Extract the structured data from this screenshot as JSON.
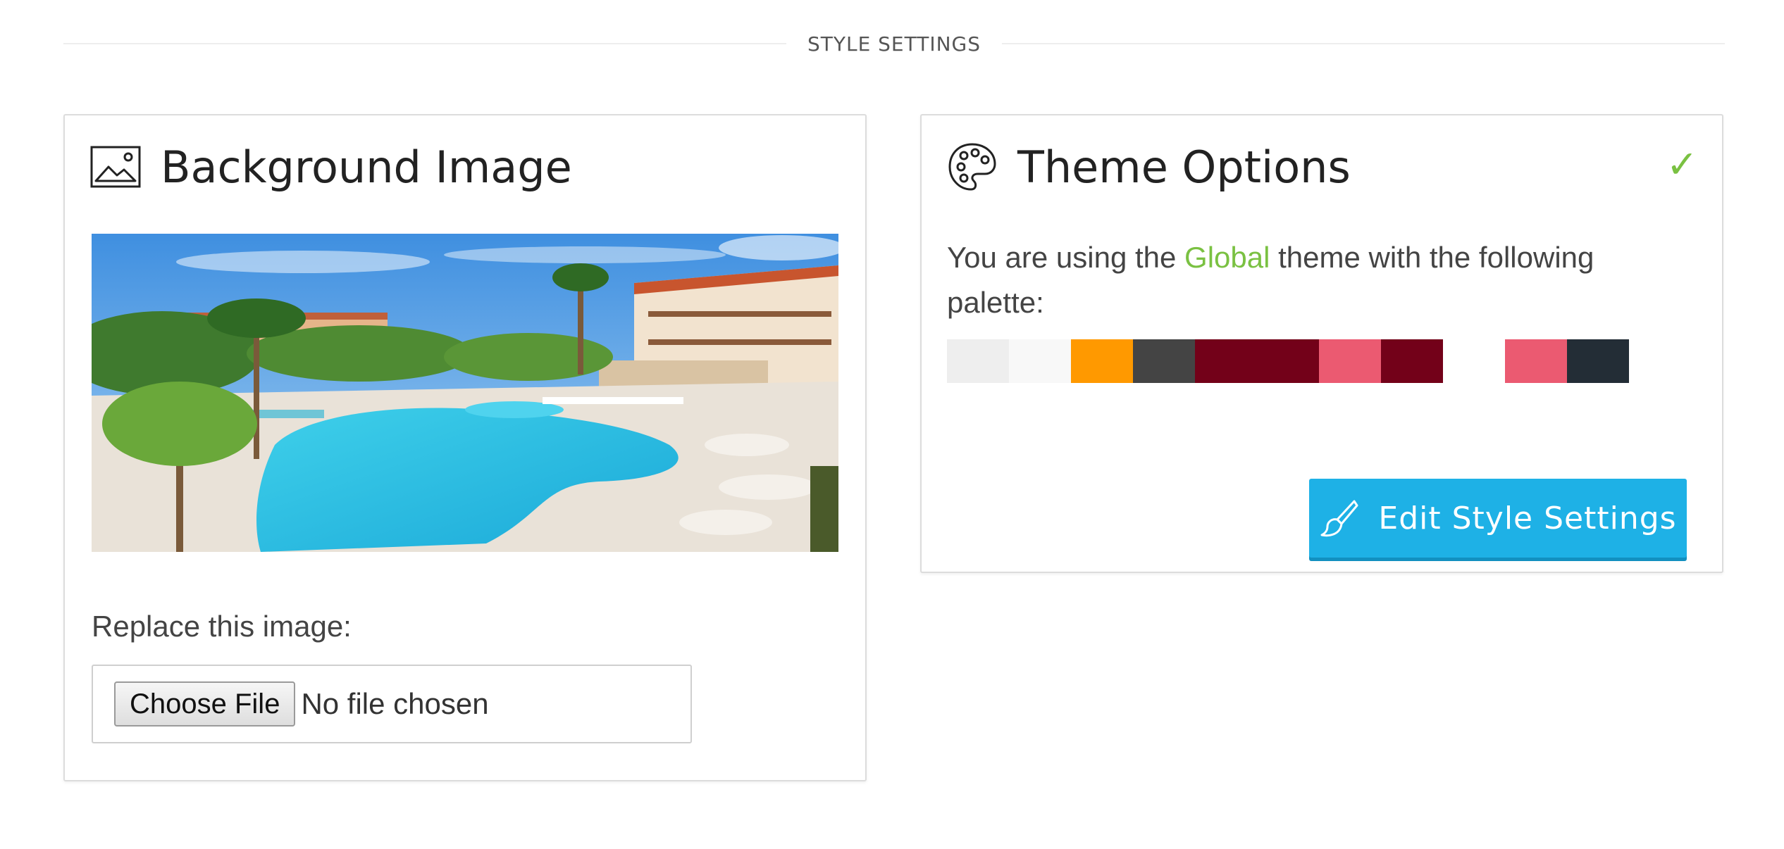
{
  "section": {
    "title": "STYLE SETTINGS"
  },
  "background_panel": {
    "title": "Background Image",
    "icon": "image-icon",
    "replace_label": "Replace this image:",
    "file_button_label": "Choose File",
    "file_status": "No file chosen"
  },
  "theme_panel": {
    "title": "Theme Options",
    "icon": "palette-icon",
    "status_icon": "checkmark-icon",
    "status_glyph": "✓",
    "text_before": "You are using the ",
    "theme_name": "Global",
    "text_after": " theme with the following palette:",
    "palette": [
      "#eeeeee",
      "#f8f8f8",
      "#ff9900",
      "#444444",
      "#730119",
      "#730119",
      "#eb5a71",
      "#730119",
      "#ffffff",
      "#eb5a71",
      "#232d36"
    ],
    "button_label": "Edit Style Settings",
    "button_icon": "paintbrush-icon"
  },
  "colors": {
    "accent_green": "#7ac142",
    "button_blue": "#1eb1e6"
  }
}
